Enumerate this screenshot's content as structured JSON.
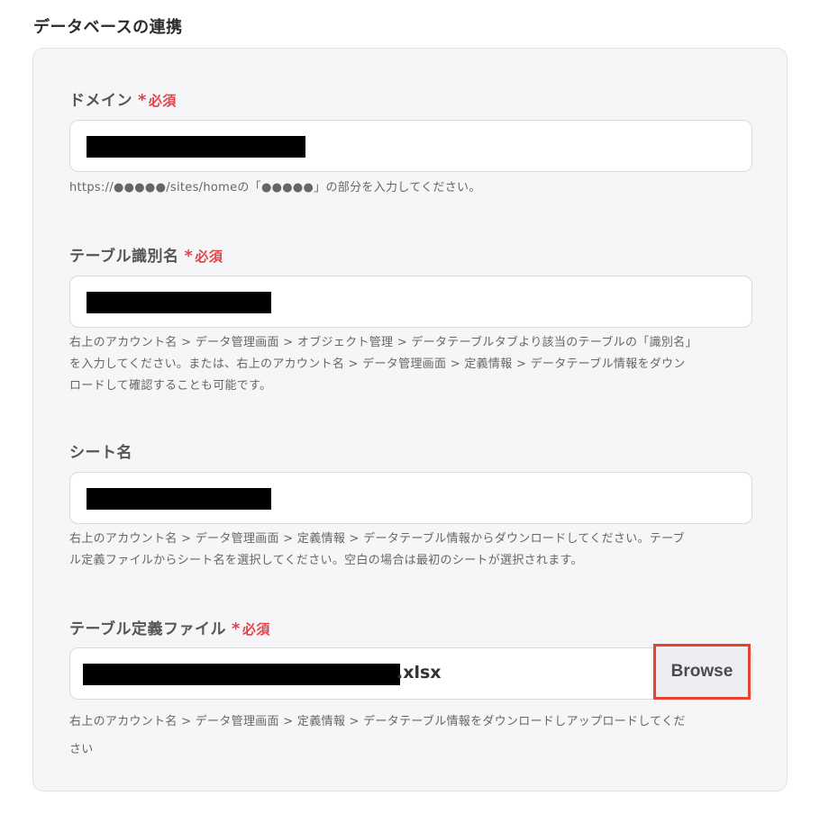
{
  "page_title": "データベースの連携",
  "required_star": "*",
  "required_label": "必須",
  "fields": [
    {
      "label": "ドメイン",
      "required": true,
      "help": "https://●●●●●/sites/homeの「●●●●●」の部分を入力してください。"
    },
    {
      "label": "テーブル識別名",
      "required": true,
      "help_lines": [
        "右上のアカウント名 > データ管理画面 > オブジェクト管理 > データテーブルタブより該当のテーブルの「識別名」",
        "を入力してください。または、右上のアカウント名 > データ管理画面 > 定義情報 > データテーブル情報をダウン",
        "ロードして確認することも可能です。"
      ]
    },
    {
      "label": "シート名",
      "required": false,
      "help_lines": [
        "右上のアカウント名 > データ管理画面 > 定義情報 > データテーブル情報からダウンロードしてください。テーブ",
        "ル定義ファイルからシート名を選択してください。空白の場合は最初のシートが選択されます。"
      ]
    },
    {
      "label": "テーブル定義ファイル",
      "required": true,
      "file_suffix": ".xlsx",
      "browse_label": "Browse",
      "help_lines": [
        "右上のアカウント名 > データ管理画面 > 定義情報 > データテーブル情報をダウンロードしアップロードしてくだ",
        "さい"
      ]
    }
  ],
  "colors": {
    "required": "#e2424a",
    "browse_highlight": "#e5432b",
    "panel_bg": "#f6f6f8"
  }
}
